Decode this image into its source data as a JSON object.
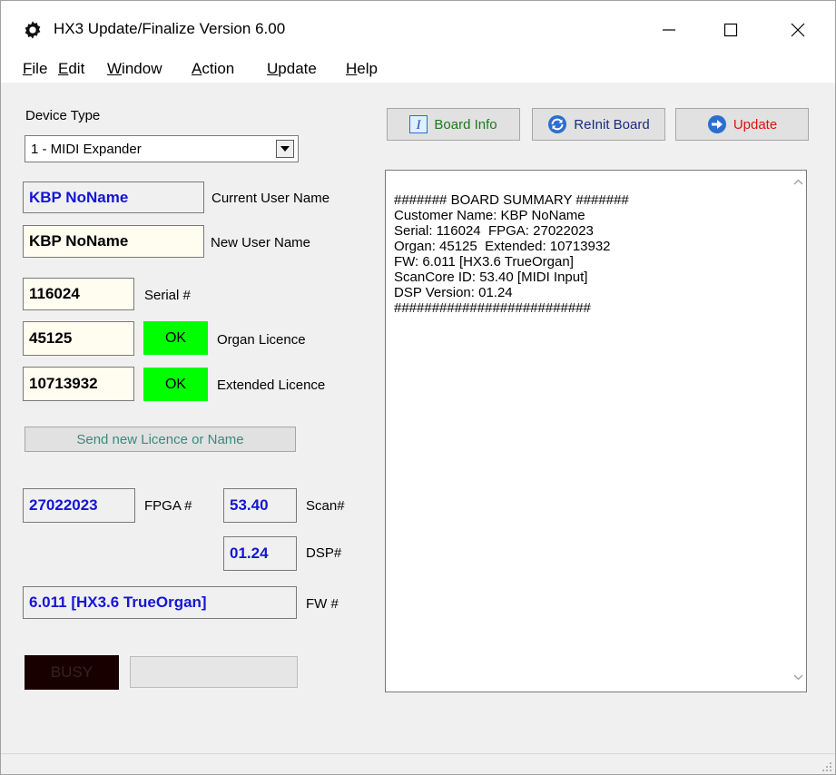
{
  "window": {
    "title": "HX3 Update/Finalize Version 6.00",
    "icon": "gear-icon",
    "controls": [
      "minimize-icon",
      "maximize-icon",
      "close-icon"
    ]
  },
  "menu": [
    "File",
    "Edit",
    "Window",
    "Action",
    "Update",
    "Help"
  ],
  "device": {
    "label": "Device Type",
    "selected": "1 - MIDI Expander"
  },
  "user": {
    "current_name": "KBP NoName",
    "current_label": "Current User Name",
    "new_name": "KBP NoName",
    "new_label": "New User Name"
  },
  "serial": {
    "value": "116024",
    "label": "Serial #"
  },
  "organ_licence": {
    "value": "45125",
    "status": "OK",
    "label": "Organ Licence"
  },
  "extended_licence": {
    "value": "10713932",
    "status": "OK",
    "label": "Extended Licence"
  },
  "send_button": "Send new Licence or Name",
  "fpga": {
    "value": "27022023",
    "label": "FPGA #"
  },
  "scan": {
    "value": "53.40",
    "label": "Scan#"
  },
  "dsp": {
    "value": "01.24",
    "label": "DSP#"
  },
  "fw": {
    "value": "6.011 [HX3.6 TrueOrgan]",
    "label": "FW #"
  },
  "busy_label": "BUSY",
  "toolbar": {
    "board_info": "Board Info",
    "reinit": "ReInit Board",
    "update": "Update"
  },
  "summary_lines": [
    "####### BOARD SUMMARY #######",
    "Customer Name: KBP NoName",
    "Serial: 116024  FPGA: 27022023",
    "Organ: 45125  Extended: 10713932",
    "FW: 6.011 [HX3.6 TrueOrgan]",
    "ScanCore ID: 53.40 [MIDI Input]",
    "DSP Version: 01.24",
    "##########################"
  ],
  "colors": {
    "ok_green": "#00ff00",
    "value_blue": "#1515d6",
    "board_info_text": "#1a7a1a",
    "reinit_text": "#1a2a80",
    "update_text": "#e01010",
    "send_text": "#3a8a7a"
  }
}
